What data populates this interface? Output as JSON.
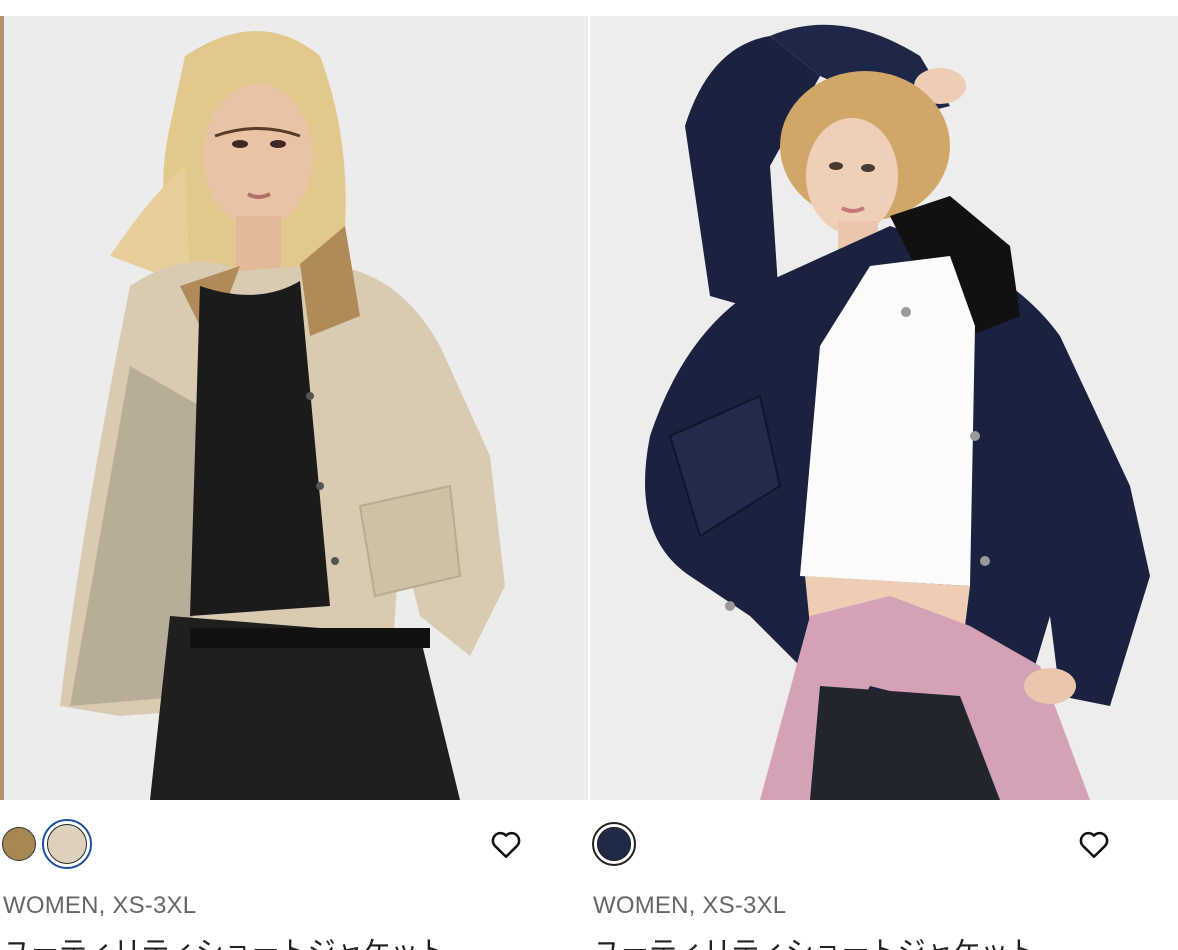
{
  "products": [
    {
      "swatches": [
        {
          "name": "brown",
          "color": "#a88755",
          "selected": false
        },
        {
          "name": "beige",
          "color": "#ddd1bd",
          "selected": true
        }
      ],
      "meta": "WOMEN, XS-3XL",
      "title": "ユーティリティショートジャケット",
      "favorite_icon": "heart-outline-icon",
      "colors": {
        "jacket": "#d8cbb2",
        "collar": "#b08a58",
        "top": "#1b1b1b",
        "skirt": "#1f1f1f",
        "hair": "#e2c88c"
      }
    },
    {
      "swatches": [
        {
          "name": "navy",
          "color": "#1e2a48",
          "selected": true
        }
      ],
      "meta": "WOMEN, XS-3XL",
      "title": "ユーティリティショートジャケット",
      "favorite_icon": "heart-outline-icon",
      "colors": {
        "jacket": "#1a2240",
        "collar": "#111",
        "top": "#ffffff",
        "scarf": "#d4a1b6",
        "jeans": "#22252d",
        "hair": "#d0a766"
      }
    }
  ]
}
